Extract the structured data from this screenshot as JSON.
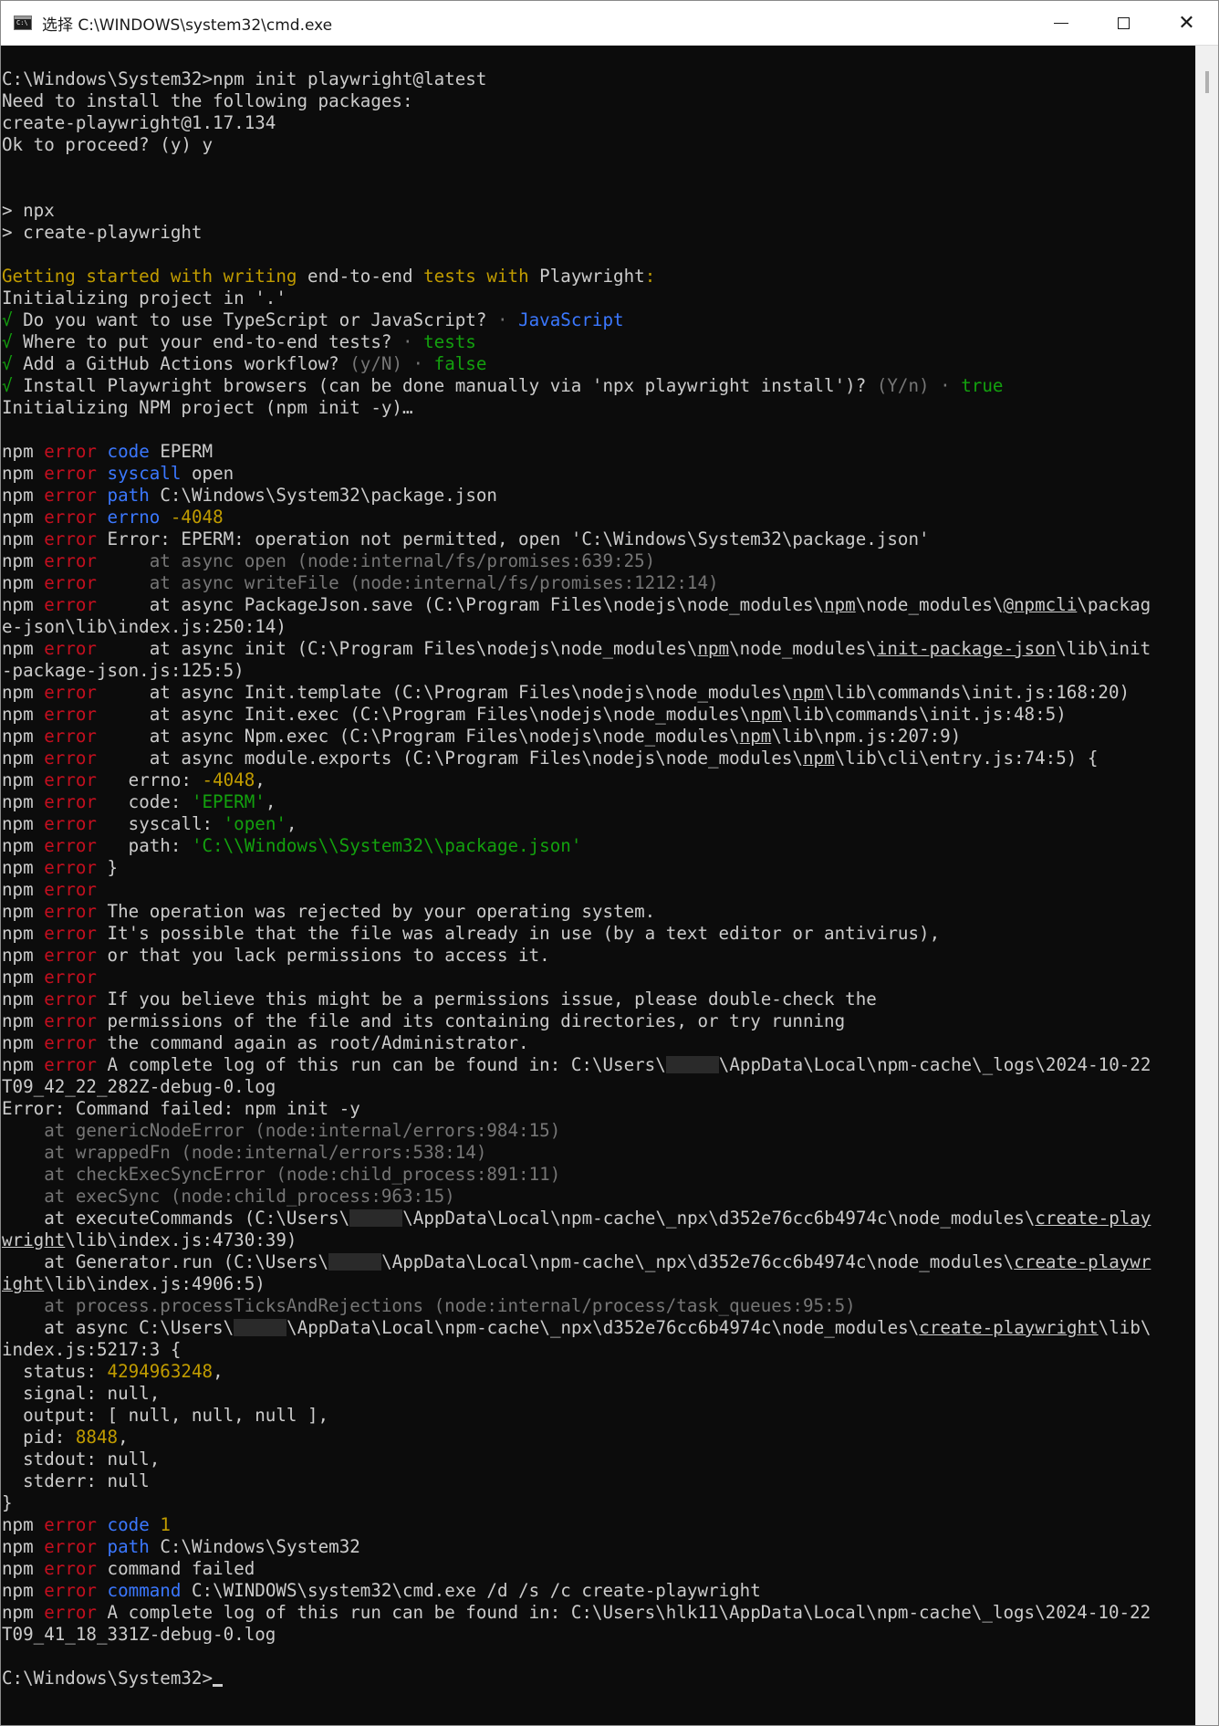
{
  "window": {
    "title": "选择 C:\\WINDOWS\\system32\\cmd.exe",
    "controls": {
      "close_glyph": "✕"
    }
  },
  "console": {
    "lines": [
      [
        [
          "C:\\Windows\\System32>npm init playwright@latest",
          "w"
        ]
      ],
      [
        [
          "Need to install the following packages:",
          "w"
        ]
      ],
      [
        [
          "create-playwright@1.17.134",
          "w"
        ]
      ],
      [
        [
          "Ok to proceed? (y) y",
          "w"
        ]
      ],
      [],
      [],
      [
        [
          "> npx",
          "w"
        ]
      ],
      [
        [
          "> create-playwright",
          "w"
        ]
      ],
      [],
      [
        [
          "Getting started with writing ",
          "y"
        ],
        [
          "end-to-end",
          "w"
        ],
        [
          " tests",
          "y"
        ],
        [
          " with ",
          "y"
        ],
        [
          "Playwright",
          "w"
        ],
        [
          ":",
          "y"
        ]
      ],
      [
        [
          "Initializing project in '.'",
          "w"
        ]
      ],
      [
        [
          "√",
          "g"
        ],
        [
          " Do you want to use TypeScript or JavaScript? ",
          "w"
        ],
        [
          "· ",
          "d"
        ],
        [
          "JavaScript",
          "b"
        ]
      ],
      [
        [
          "√",
          "g"
        ],
        [
          " Where to put your end-to-end tests? ",
          "w"
        ],
        [
          "· ",
          "d"
        ],
        [
          "tests",
          "g"
        ]
      ],
      [
        [
          "√",
          "g"
        ],
        [
          " Add a GitHub Actions workflow? ",
          "w"
        ],
        [
          "(y/N) · ",
          "d"
        ],
        [
          "false",
          "g"
        ]
      ],
      [
        [
          "√",
          "g"
        ],
        [
          " Install Playwright browsers (can be done manually via 'npx playwright install')? ",
          "w"
        ],
        [
          "(Y/n) · ",
          "d"
        ],
        [
          "true",
          "g"
        ]
      ],
      [
        [
          "Initializing NPM project (npm init -y)…",
          "w"
        ]
      ],
      [],
      [
        [
          "npm ",
          "w"
        ],
        [
          "error",
          "r"
        ],
        [
          " ",
          "w"
        ],
        [
          "code",
          "b"
        ],
        [
          " EPERM",
          "w"
        ]
      ],
      [
        [
          "npm ",
          "w"
        ],
        [
          "error",
          "r"
        ],
        [
          " ",
          "w"
        ],
        [
          "syscall",
          "b"
        ],
        [
          " open",
          "w"
        ]
      ],
      [
        [
          "npm ",
          "w"
        ],
        [
          "error",
          "r"
        ],
        [
          " ",
          "w"
        ],
        [
          "path",
          "b"
        ],
        [
          " C:\\Windows\\System32\\package.json",
          "w"
        ]
      ],
      [
        [
          "npm ",
          "w"
        ],
        [
          "error",
          "r"
        ],
        [
          " ",
          "w"
        ],
        [
          "errno",
          "b"
        ],
        [
          " -4048",
          "y"
        ]
      ],
      [
        [
          "npm ",
          "w"
        ],
        [
          "error",
          "r"
        ],
        [
          " Error: EPERM: operation not permitted, open 'C:\\Windows\\System32\\package.json'",
          "w"
        ]
      ],
      [
        [
          "npm ",
          "w"
        ],
        [
          "error",
          "r"
        ],
        [
          "     at async open (node:internal/fs/promises:639:25)",
          "d"
        ]
      ],
      [
        [
          "npm ",
          "w"
        ],
        [
          "error",
          "r"
        ],
        [
          "     at async writeFile (node:internal/fs/promises:1212:14)",
          "d"
        ]
      ],
      [
        [
          "npm ",
          "w"
        ],
        [
          "error",
          "r"
        ],
        [
          "     at async PackageJson.save (C:\\Program Files\\nodejs\\node_modules\\",
          "w"
        ],
        [
          "npm",
          "wu"
        ],
        [
          "\\node_modules\\",
          "w"
        ],
        [
          "@npmcli",
          "wu"
        ],
        [
          "\\packag",
          "w"
        ]
      ],
      [
        [
          "e-json\\lib\\index.js:250:14)",
          "w"
        ]
      ],
      [
        [
          "npm ",
          "w"
        ],
        [
          "error",
          "r"
        ],
        [
          "     at async init (C:\\Program Files\\nodejs\\node_modules\\",
          "w"
        ],
        [
          "npm",
          "wu"
        ],
        [
          "\\node_modules\\",
          "w"
        ],
        [
          "init-package-json",
          "wu"
        ],
        [
          "\\lib\\init",
          "w"
        ]
      ],
      [
        [
          "-package-json.js:125:5)",
          "w"
        ]
      ],
      [
        [
          "npm ",
          "w"
        ],
        [
          "error",
          "r"
        ],
        [
          "     at async Init.template (C:\\Program Files\\nodejs\\node_modules\\",
          "w"
        ],
        [
          "npm",
          "wu"
        ],
        [
          "\\lib\\commands\\init.js:168:20)",
          "w"
        ]
      ],
      [
        [
          "npm ",
          "w"
        ],
        [
          "error",
          "r"
        ],
        [
          "     at async Init.exec (C:\\Program Files\\nodejs\\node_modules\\",
          "w"
        ],
        [
          "npm",
          "wu"
        ],
        [
          "\\lib\\commands\\init.js:48:5)",
          "w"
        ]
      ],
      [
        [
          "npm ",
          "w"
        ],
        [
          "error",
          "r"
        ],
        [
          "     at async Npm.exec (C:\\Program Files\\nodejs\\node_modules\\",
          "w"
        ],
        [
          "npm",
          "wu"
        ],
        [
          "\\lib\\npm.js:207:9)",
          "w"
        ]
      ],
      [
        [
          "npm ",
          "w"
        ],
        [
          "error",
          "r"
        ],
        [
          "     at async module.exports (C:\\Program Files\\nodejs\\node_modules\\",
          "w"
        ],
        [
          "npm",
          "wu"
        ],
        [
          "\\lib\\cli\\entry.js:74:5) {",
          "w"
        ]
      ],
      [
        [
          "npm ",
          "w"
        ],
        [
          "error",
          "r"
        ],
        [
          "   errno: ",
          "w"
        ],
        [
          "-4048",
          "y"
        ],
        [
          ",",
          "w"
        ]
      ],
      [
        [
          "npm ",
          "w"
        ],
        [
          "error",
          "r"
        ],
        [
          "   code: ",
          "w"
        ],
        [
          "'EPERM'",
          "g"
        ],
        [
          ",",
          "w"
        ]
      ],
      [
        [
          "npm ",
          "w"
        ],
        [
          "error",
          "r"
        ],
        [
          "   syscall: ",
          "w"
        ],
        [
          "'open'",
          "g"
        ],
        [
          ",",
          "w"
        ]
      ],
      [
        [
          "npm ",
          "w"
        ],
        [
          "error",
          "r"
        ],
        [
          "   path: ",
          "w"
        ],
        [
          "'C:\\\\Windows\\\\System32\\\\package.json'",
          "g"
        ]
      ],
      [
        [
          "npm ",
          "w"
        ],
        [
          "error",
          "r"
        ],
        [
          " }",
          "w"
        ]
      ],
      [
        [
          "npm ",
          "w"
        ],
        [
          "error",
          "r"
        ]
      ],
      [
        [
          "npm ",
          "w"
        ],
        [
          "error",
          "r"
        ],
        [
          " The operation was rejected by your operating system.",
          "w"
        ]
      ],
      [
        [
          "npm ",
          "w"
        ],
        [
          "error",
          "r"
        ],
        [
          " It's possible that the file was already in use (by a text editor or antivirus),",
          "w"
        ]
      ],
      [
        [
          "npm ",
          "w"
        ],
        [
          "error",
          "r"
        ],
        [
          " or that you lack permissions to access it.",
          "w"
        ]
      ],
      [
        [
          "npm ",
          "w"
        ],
        [
          "error",
          "r"
        ]
      ],
      [
        [
          "npm ",
          "w"
        ],
        [
          "error",
          "r"
        ],
        [
          " If you believe this might be a permissions issue, please double-check the",
          "w"
        ]
      ],
      [
        [
          "npm ",
          "w"
        ],
        [
          "error",
          "r"
        ],
        [
          " permissions of the file and its containing directories, or try running",
          "w"
        ]
      ],
      [
        [
          "npm ",
          "w"
        ],
        [
          "error",
          "r"
        ],
        [
          " the command again as root/Administrator.",
          "w"
        ]
      ],
      [
        [
          "npm ",
          "w"
        ],
        [
          "error",
          "r"
        ],
        [
          " A complete log of this run can be found in: C:\\Users\\",
          "w"
        ],
        [
          "",
          "redact"
        ],
        [
          "\\AppData\\Local\\npm-cache\\_logs\\2024-10-22",
          "w"
        ]
      ],
      [
        [
          "T09_42_22_282Z-debug-0.log",
          "w"
        ]
      ],
      [
        [
          "Error: Command failed: npm init -y",
          "w"
        ]
      ],
      [
        [
          "    at genericNodeError (node:internal/errors:984:15)",
          "d"
        ]
      ],
      [
        [
          "    at wrappedFn (node:internal/errors:538:14)",
          "d"
        ]
      ],
      [
        [
          "    at checkExecSyncError (node:child_process:891:11)",
          "d"
        ]
      ],
      [
        [
          "    at execSync (node:child_process:963:15)",
          "d"
        ]
      ],
      [
        [
          "    at executeCommands (C:\\Users\\",
          "w"
        ],
        [
          "",
          "redact"
        ],
        [
          "\\AppData\\Local\\npm-cache\\_npx\\d352e76cc6b4974c\\node_modules\\",
          "w"
        ],
        [
          "create-play",
          "wu"
        ]
      ],
      [
        [
          "wright",
          "wu"
        ],
        [
          "\\lib\\index.js:4730:39)",
          "w"
        ]
      ],
      [
        [
          "    at Generator.run (C:\\Users\\",
          "w"
        ],
        [
          "",
          "redact"
        ],
        [
          "\\AppData\\Local\\npm-cache\\_npx\\d352e76cc6b4974c\\node_modules\\",
          "w"
        ],
        [
          "create-playwr",
          "wu"
        ]
      ],
      [
        [
          "ight",
          "wu"
        ],
        [
          "\\lib\\index.js:4906:5)",
          "w"
        ]
      ],
      [
        [
          "    at process.processTicksAndRejections (node:internal/process/task_queues:95:5)",
          "d"
        ]
      ],
      [
        [
          "    at async C:\\Users\\",
          "w"
        ],
        [
          "",
          "redact"
        ],
        [
          "\\AppData\\Local\\npm-cache\\_npx\\d352e76cc6b4974c\\node_modules\\",
          "w"
        ],
        [
          "create-playwright",
          "wu"
        ],
        [
          "\\lib\\",
          "w"
        ]
      ],
      [
        [
          "index.js:5217:3 {",
          "w"
        ]
      ],
      [
        [
          "  status: ",
          "w"
        ],
        [
          "4294963248",
          "y"
        ],
        [
          ",",
          "w"
        ]
      ],
      [
        [
          "  signal: null,",
          "w"
        ]
      ],
      [
        [
          "  output: [ null, null, null ],",
          "w"
        ]
      ],
      [
        [
          "  pid: ",
          "w"
        ],
        [
          "8848",
          "y"
        ],
        [
          ",",
          "w"
        ]
      ],
      [
        [
          "  stdout: null,",
          "w"
        ]
      ],
      [
        [
          "  stderr: null",
          "w"
        ]
      ],
      [
        [
          "}",
          "w"
        ]
      ],
      [
        [
          "npm ",
          "w"
        ],
        [
          "error",
          "r"
        ],
        [
          " ",
          "w"
        ],
        [
          "code",
          "b"
        ],
        [
          " ",
          "w"
        ],
        [
          "1",
          "y"
        ]
      ],
      [
        [
          "npm ",
          "w"
        ],
        [
          "error",
          "r"
        ],
        [
          " ",
          "w"
        ],
        [
          "path",
          "b"
        ],
        [
          " C:\\Windows\\System32",
          "w"
        ]
      ],
      [
        [
          "npm ",
          "w"
        ],
        [
          "error",
          "r"
        ],
        [
          " command failed",
          "w"
        ]
      ],
      [
        [
          "npm ",
          "w"
        ],
        [
          "error",
          "r"
        ],
        [
          " ",
          "w"
        ],
        [
          "command",
          "b"
        ],
        [
          " C:\\WINDOWS\\system32\\cmd.exe /d /s /c create-playwright",
          "w"
        ]
      ],
      [
        [
          "npm ",
          "w"
        ],
        [
          "error",
          "r"
        ],
        [
          " A complete log of this run can be found in: C:\\Users\\hlk11\\AppData\\Local\\npm-cache\\_logs\\2024-10-22",
          "w"
        ]
      ],
      [
        [
          "T09_41_18_331Z-debug-0.log",
          "w"
        ]
      ],
      [],
      [
        [
          "C:\\Windows\\System32>",
          "w"
        ],
        [
          "",
          "cursor"
        ]
      ]
    ]
  },
  "colors": {
    "background": "#0c0c0c",
    "foreground": "#cccccc",
    "error_red": "#c50f1f",
    "key_blue": "#3b78ff",
    "number_yellow": "#c19c00",
    "string_green": "#13a10e",
    "dim_gray": "#767676"
  },
  "icons": {
    "app": "cmd-icon",
    "minimize": "minimize-icon",
    "maximize": "maximize-icon",
    "close": "close-icon"
  }
}
